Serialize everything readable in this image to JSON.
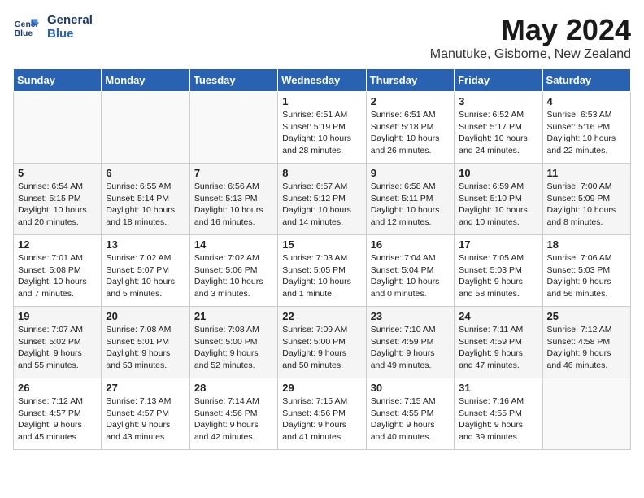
{
  "header": {
    "logo_line1": "General",
    "logo_line2": "Blue",
    "month_title": "May 2024",
    "location": "Manutuke, Gisborne, New Zealand"
  },
  "days_of_week": [
    "Sunday",
    "Monday",
    "Tuesday",
    "Wednesday",
    "Thursday",
    "Friday",
    "Saturday"
  ],
  "weeks": [
    [
      {
        "day": "",
        "detail": ""
      },
      {
        "day": "",
        "detail": ""
      },
      {
        "day": "",
        "detail": ""
      },
      {
        "day": "1",
        "detail": "Sunrise: 6:51 AM\nSunset: 5:19 PM\nDaylight: 10 hours\nand 28 minutes."
      },
      {
        "day": "2",
        "detail": "Sunrise: 6:51 AM\nSunset: 5:18 PM\nDaylight: 10 hours\nand 26 minutes."
      },
      {
        "day": "3",
        "detail": "Sunrise: 6:52 AM\nSunset: 5:17 PM\nDaylight: 10 hours\nand 24 minutes."
      },
      {
        "day": "4",
        "detail": "Sunrise: 6:53 AM\nSunset: 5:16 PM\nDaylight: 10 hours\nand 22 minutes."
      }
    ],
    [
      {
        "day": "5",
        "detail": "Sunrise: 6:54 AM\nSunset: 5:15 PM\nDaylight: 10 hours\nand 20 minutes."
      },
      {
        "day": "6",
        "detail": "Sunrise: 6:55 AM\nSunset: 5:14 PM\nDaylight: 10 hours\nand 18 minutes."
      },
      {
        "day": "7",
        "detail": "Sunrise: 6:56 AM\nSunset: 5:13 PM\nDaylight: 10 hours\nand 16 minutes."
      },
      {
        "day": "8",
        "detail": "Sunrise: 6:57 AM\nSunset: 5:12 PM\nDaylight: 10 hours\nand 14 minutes."
      },
      {
        "day": "9",
        "detail": "Sunrise: 6:58 AM\nSunset: 5:11 PM\nDaylight: 10 hours\nand 12 minutes."
      },
      {
        "day": "10",
        "detail": "Sunrise: 6:59 AM\nSunset: 5:10 PM\nDaylight: 10 hours\nand 10 minutes."
      },
      {
        "day": "11",
        "detail": "Sunrise: 7:00 AM\nSunset: 5:09 PM\nDaylight: 10 hours\nand 8 minutes."
      }
    ],
    [
      {
        "day": "12",
        "detail": "Sunrise: 7:01 AM\nSunset: 5:08 PM\nDaylight: 10 hours\nand 7 minutes."
      },
      {
        "day": "13",
        "detail": "Sunrise: 7:02 AM\nSunset: 5:07 PM\nDaylight: 10 hours\nand 5 minutes."
      },
      {
        "day": "14",
        "detail": "Sunrise: 7:02 AM\nSunset: 5:06 PM\nDaylight: 10 hours\nand 3 minutes."
      },
      {
        "day": "15",
        "detail": "Sunrise: 7:03 AM\nSunset: 5:05 PM\nDaylight: 10 hours\nand 1 minute."
      },
      {
        "day": "16",
        "detail": "Sunrise: 7:04 AM\nSunset: 5:04 PM\nDaylight: 10 hours\nand 0 minutes."
      },
      {
        "day": "17",
        "detail": "Sunrise: 7:05 AM\nSunset: 5:03 PM\nDaylight: 9 hours\nand 58 minutes."
      },
      {
        "day": "18",
        "detail": "Sunrise: 7:06 AM\nSunset: 5:03 PM\nDaylight: 9 hours\nand 56 minutes."
      }
    ],
    [
      {
        "day": "19",
        "detail": "Sunrise: 7:07 AM\nSunset: 5:02 PM\nDaylight: 9 hours\nand 55 minutes."
      },
      {
        "day": "20",
        "detail": "Sunrise: 7:08 AM\nSunset: 5:01 PM\nDaylight: 9 hours\nand 53 minutes."
      },
      {
        "day": "21",
        "detail": "Sunrise: 7:08 AM\nSunset: 5:00 PM\nDaylight: 9 hours\nand 52 minutes."
      },
      {
        "day": "22",
        "detail": "Sunrise: 7:09 AM\nSunset: 5:00 PM\nDaylight: 9 hours\nand 50 minutes."
      },
      {
        "day": "23",
        "detail": "Sunrise: 7:10 AM\nSunset: 4:59 PM\nDaylight: 9 hours\nand 49 minutes."
      },
      {
        "day": "24",
        "detail": "Sunrise: 7:11 AM\nSunset: 4:59 PM\nDaylight: 9 hours\nand 47 minutes."
      },
      {
        "day": "25",
        "detail": "Sunrise: 7:12 AM\nSunset: 4:58 PM\nDaylight: 9 hours\nand 46 minutes."
      }
    ],
    [
      {
        "day": "26",
        "detail": "Sunrise: 7:12 AM\nSunset: 4:57 PM\nDaylight: 9 hours\nand 45 minutes."
      },
      {
        "day": "27",
        "detail": "Sunrise: 7:13 AM\nSunset: 4:57 PM\nDaylight: 9 hours\nand 43 minutes."
      },
      {
        "day": "28",
        "detail": "Sunrise: 7:14 AM\nSunset: 4:56 PM\nDaylight: 9 hours\nand 42 minutes."
      },
      {
        "day": "29",
        "detail": "Sunrise: 7:15 AM\nSunset: 4:56 PM\nDaylight: 9 hours\nand 41 minutes."
      },
      {
        "day": "30",
        "detail": "Sunrise: 7:15 AM\nSunset: 4:55 PM\nDaylight: 9 hours\nand 40 minutes."
      },
      {
        "day": "31",
        "detail": "Sunrise: 7:16 AM\nSunset: 4:55 PM\nDaylight: 9 hours\nand 39 minutes."
      },
      {
        "day": "",
        "detail": ""
      }
    ]
  ]
}
